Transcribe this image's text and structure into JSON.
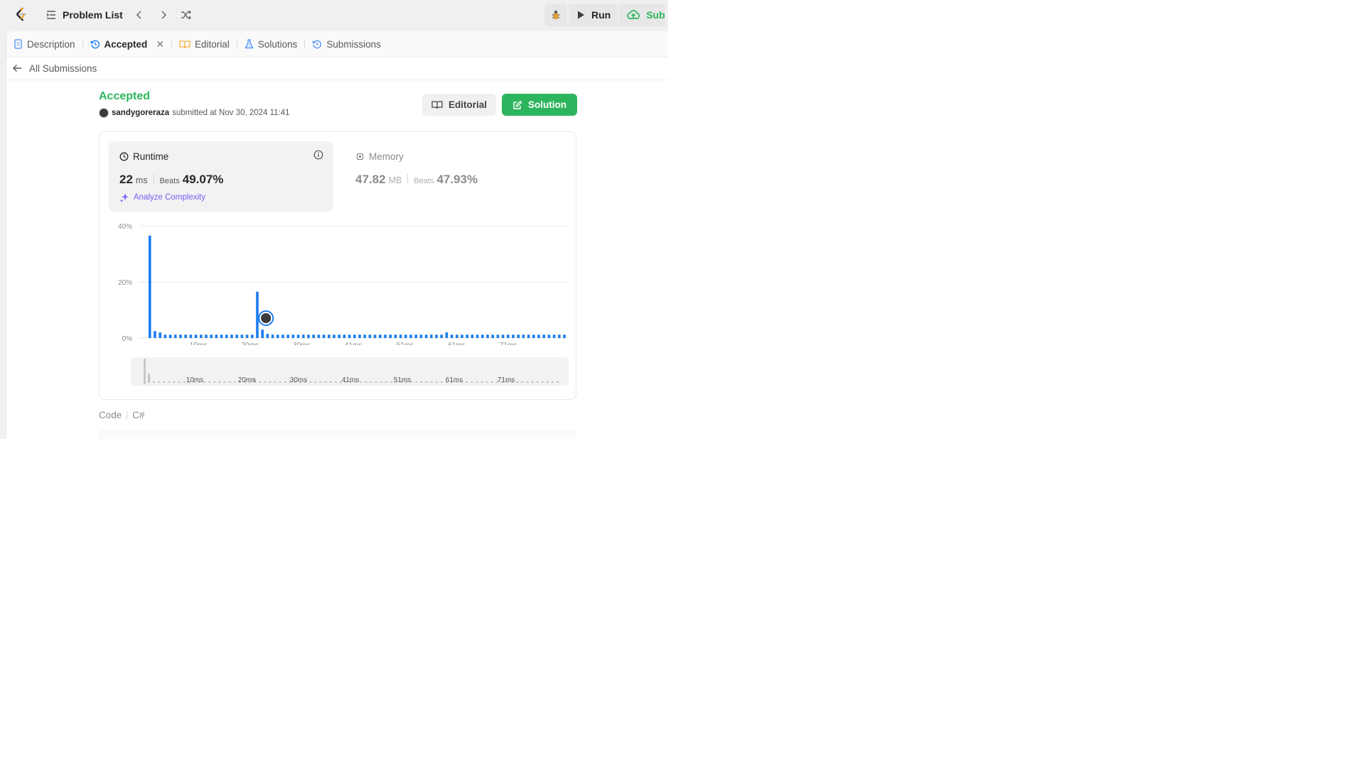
{
  "nav": {
    "problem_list_label": "Problem List"
  },
  "actions": {
    "run_label": "Run",
    "submit_label": "Sub"
  },
  "tabs": [
    {
      "label": "Description"
    },
    {
      "label": "Accepted"
    },
    {
      "label": "Editorial"
    },
    {
      "label": "Solutions"
    },
    {
      "label": "Submissions"
    }
  ],
  "back": {
    "label": "All Submissions"
  },
  "submission": {
    "status": "Accepted",
    "user": "sandygoreraza",
    "submitted_text": "submitted at Nov 30, 2024 11:41",
    "editorial_btn": "Editorial",
    "solution_btn": "Solution"
  },
  "runtime": {
    "title": "Runtime",
    "value": "22",
    "unit": "ms",
    "beats_label": "Beats",
    "beats_value": "49.07%",
    "analyze_label": "Analyze Complexity"
  },
  "memory": {
    "title": "Memory",
    "value": "47.82",
    "unit": "MB",
    "beats_label": "Beats",
    "beats_value": "47.93%"
  },
  "code": {
    "label": "Code",
    "language": "C#"
  },
  "colors": {
    "accent_green": "#2db55d",
    "bar_blue": "#1a7df0",
    "purple": "#7c5cf6"
  },
  "chart_data": {
    "type": "bar",
    "yticks": [
      "40%",
      "20%",
      "0%"
    ],
    "xticks": [
      "10ms",
      "20ms",
      "30ms",
      "41ms",
      "51ms",
      "61ms",
      "71ms"
    ],
    "ylim": [
      0,
      40
    ],
    "grid": true,
    "highlight_value": 22,
    "values": [
      36.5,
      2.5,
      2,
      1.2,
      1.2,
      1.2,
      1.2,
      1.2,
      1.2,
      1.2,
      1.2,
      1.2,
      1.2,
      1.2,
      1.2,
      1.2,
      1.2,
      1.2,
      1.2,
      1.2,
      1.2,
      16.5,
      3,
      1.5,
      1.2,
      1.2,
      1.2,
      1.2,
      1.2,
      1.2,
      1.2,
      1.2,
      1.2,
      1.2,
      1.2,
      1.2,
      1.2,
      1.2,
      1.2,
      1.2,
      1.2,
      1.2,
      1.2,
      1.2,
      1.2,
      1.2,
      1.2,
      1.2,
      1.2,
      1.2,
      1.2,
      1.2,
      1.2,
      1.2,
      1.2,
      1.2,
      1.2,
      1.2,
      2,
      1.2,
      1.2,
      1.2,
      1.2,
      1.2,
      1.2,
      1.2,
      1.2,
      1.2,
      1.2,
      1.2,
      1.2,
      1.2,
      1.2,
      1.2,
      1.2,
      1.2,
      1.2,
      1.2,
      1.2,
      1.2,
      1.2,
      1.2
    ]
  }
}
